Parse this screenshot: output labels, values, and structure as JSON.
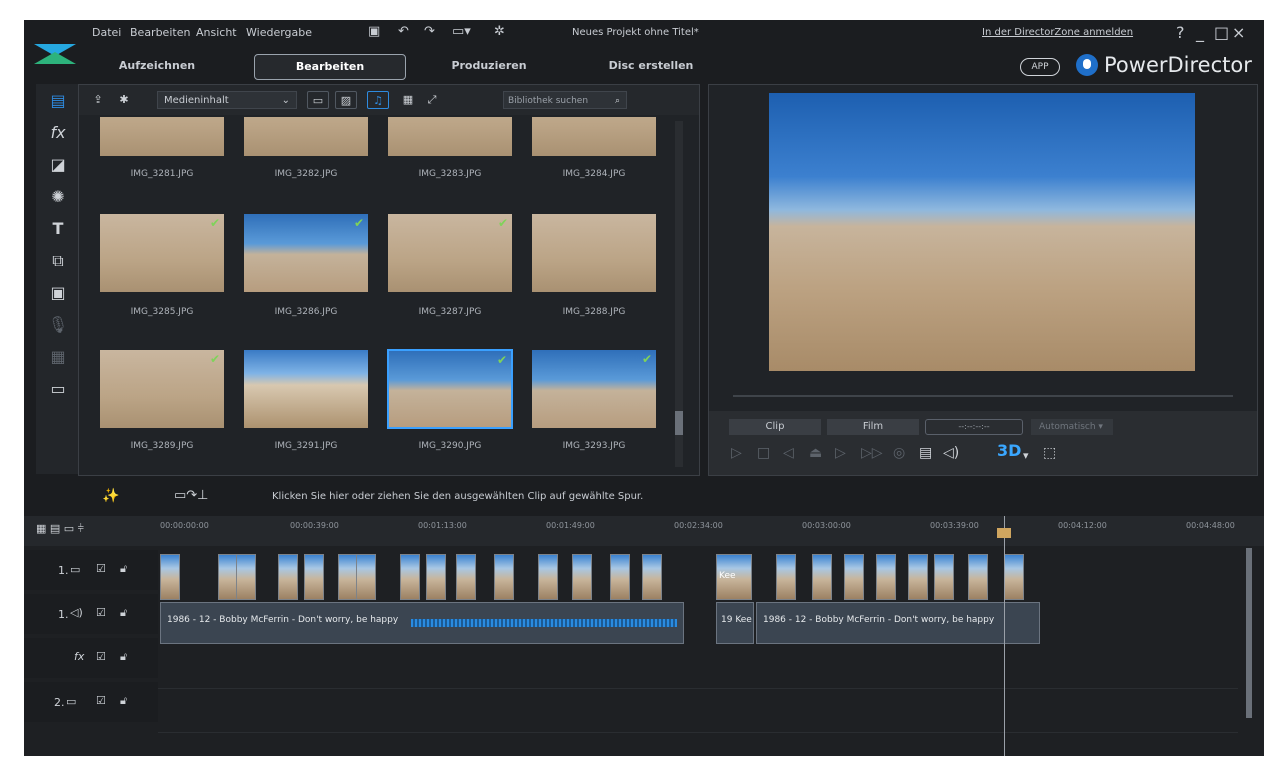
{
  "menubar": {
    "items": [
      "Datei",
      "Bearbeiten",
      "Ansicht",
      "Wiedergabe"
    ],
    "project_title": "Neues Projekt ohne Titel*",
    "directorzone_link": "In der DirectorZone anmelden",
    "help": "?",
    "minimize": "_",
    "maximize": "□",
    "close": "×"
  },
  "tabs": [
    "Aufzeichnen",
    "Bearbeiten",
    "Produzieren",
    "Disc erstellen"
  ],
  "brand": {
    "app_badge": "APP",
    "name": "PowerDirector"
  },
  "library": {
    "media_select": "Medieninhalt",
    "search_placeholder": "Bibliothek suchen",
    "items": [
      {
        "name": "IMG_3281.JPG",
        "checked": false,
        "scene": "sand"
      },
      {
        "name": "IMG_3282.JPG",
        "checked": false,
        "scene": "sand"
      },
      {
        "name": "IMG_3283.JPG",
        "checked": false,
        "scene": "sand"
      },
      {
        "name": "IMG_3284.JPG",
        "checked": false,
        "scene": "sand"
      },
      {
        "name": "IMG_3285.JPG",
        "checked": true,
        "scene": "sand"
      },
      {
        "name": "IMG_3286.JPG",
        "checked": true,
        "scene": "sky"
      },
      {
        "name": "IMG_3287.JPG",
        "checked": true,
        "scene": "sand"
      },
      {
        "name": "IMG_3288.JPG",
        "checked": false,
        "scene": "sand"
      },
      {
        "name": "IMG_3289.JPG",
        "checked": true,
        "scene": "sand"
      },
      {
        "name": "IMG_3291.JPG",
        "checked": false,
        "scene": "sky2"
      },
      {
        "name": "IMG_3290.JPG",
        "checked": true,
        "scene": "sky",
        "selected": true
      },
      {
        "name": "IMG_3293.JPG",
        "checked": true,
        "scene": "sky"
      }
    ]
  },
  "preview": {
    "tab_clip": "Clip",
    "tab_film": "Film",
    "timecode": "--:--:--:--",
    "auto_select": "Automatisch"
  },
  "midbar": {
    "hint": "Klicken Sie hier oder ziehen Sie den ausgewählten Clip auf gewählte Spur."
  },
  "ruler": {
    "ticks": [
      "00:00:00:00",
      "00:00:39:00",
      "00:01:13:00",
      "00:01:49:00",
      "00:02:34:00",
      "00:03:00:00",
      "00:03:39:00",
      "00:04:12:00",
      "00:04:48:00"
    ]
  },
  "timeline": {
    "track_labels": [
      "1.",
      "1.",
      "",
      "2."
    ],
    "audio_clip_1": "1986 - 12 - Bobby McFerrin - Don't worry, be happy",
    "audio_clip_2": "19 Kee",
    "audio_clip_3": "1986 - 12 - Bobby McFerrin - Don't worry, be happy",
    "video_text_clip": "Kee"
  }
}
